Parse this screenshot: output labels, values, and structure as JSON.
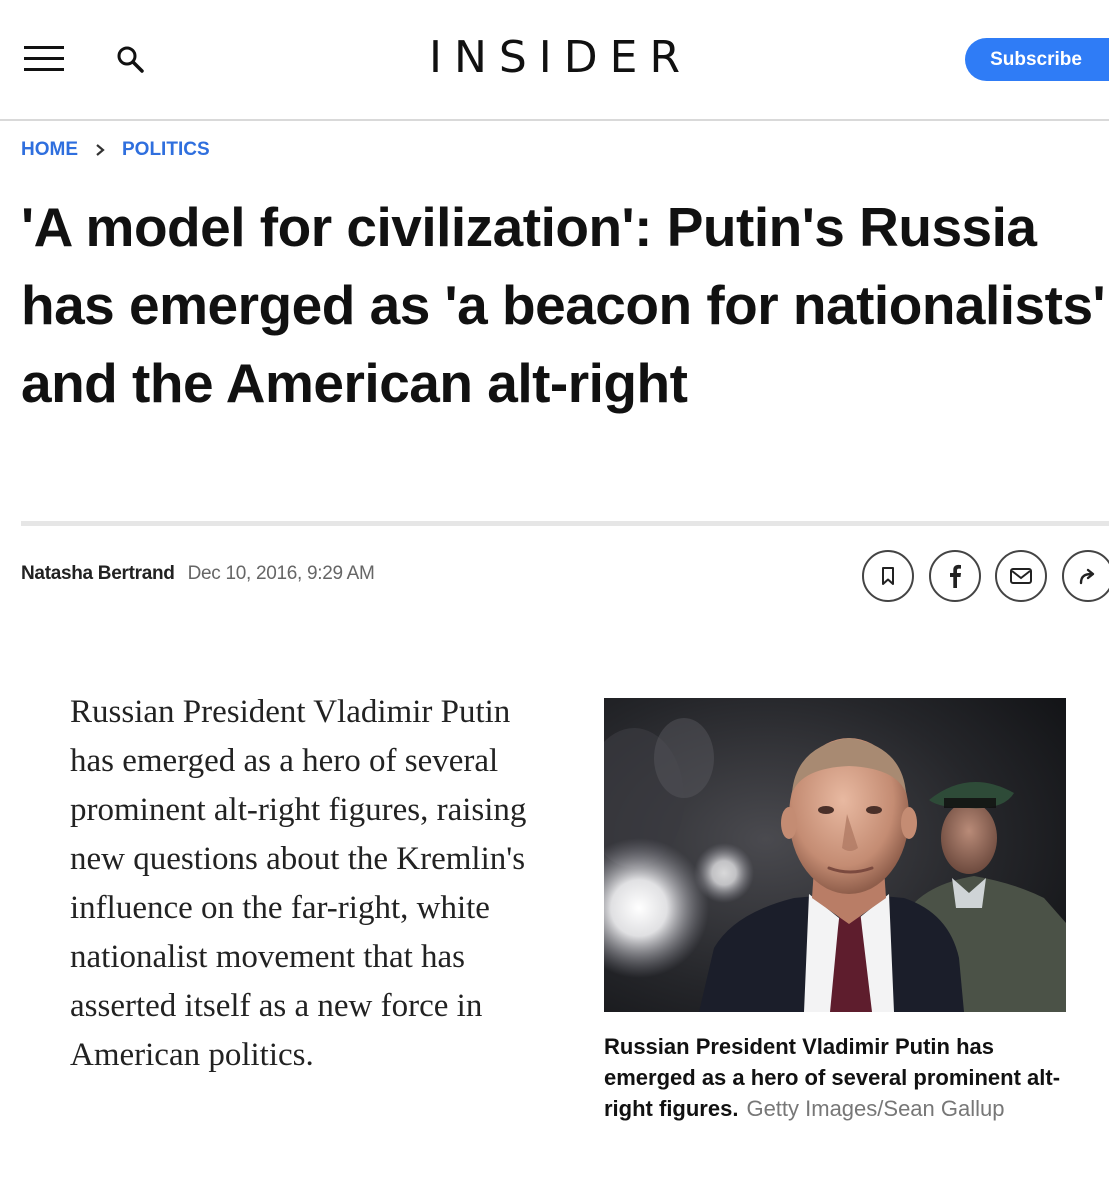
{
  "header": {
    "logo": "INSIDER",
    "subscribe_label": "Subscribe"
  },
  "breadcrumb": {
    "home": "HOME",
    "section": "POLITICS"
  },
  "article": {
    "headline": "'A model for civilization': Putin's Russia has emerged as 'a beacon for nationalists' and the American alt-right",
    "author": "Natasha Bertrand",
    "date": "Dec 10, 2016, 9:29 AM",
    "body": "Russian President Vladimir Putin has emerged as a hero of several prominent alt-right figures, raising new questions about the Kremlin's influence on the far-right, white nationalist movement that has asserted itself as a new force in American politics.",
    "image_caption": "Russian President Vladimir Putin has emerged as a hero of several prominent alt-right figures.",
    "image_credit": "Getty Images/Sean Gallup"
  },
  "share_actions": [
    "bookmark-icon",
    "facebook-icon",
    "email-icon",
    "share-arrow-icon"
  ],
  "colors": {
    "accent": "#2f7cf6",
    "link": "#2f6fde",
    "divider": "#e6e6e6"
  }
}
